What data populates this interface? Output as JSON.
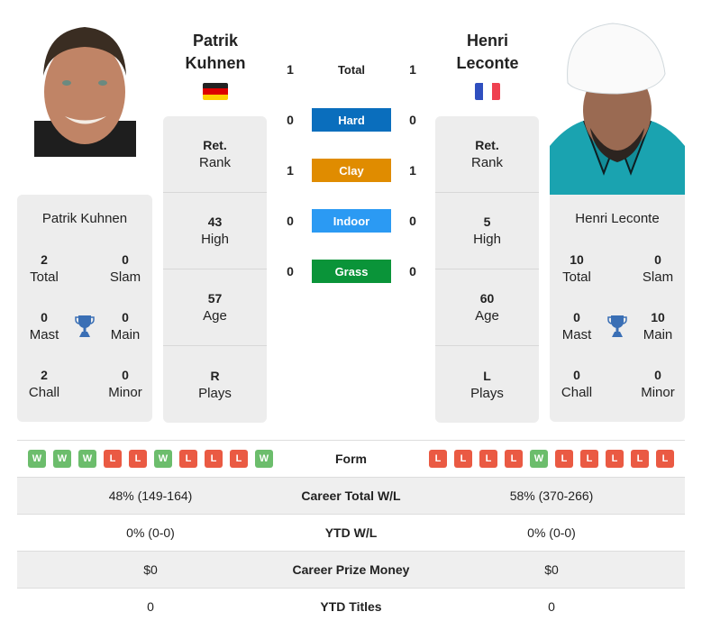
{
  "player1": {
    "name_line1": "Patrik",
    "name_line2": "Kuhnen",
    "full_name": "Patrik Kuhnen",
    "country": "Germany",
    "flag_colors": [
      "#000000",
      "#dd0000",
      "#ffce00"
    ],
    "rank": {
      "value": "Ret.",
      "label": "Rank"
    },
    "high": {
      "value": "43",
      "label": "High"
    },
    "age": {
      "value": "57",
      "label": "Age"
    },
    "plays": {
      "value": "R",
      "label": "Plays"
    },
    "titles": {
      "total": {
        "value": "2",
        "label": "Total"
      },
      "slam": {
        "value": "0",
        "label": "Slam"
      },
      "mast": {
        "value": "0",
        "label": "Mast"
      },
      "main": {
        "value": "0",
        "label": "Main"
      },
      "chall": {
        "value": "2",
        "label": "Chall"
      },
      "minor": {
        "value": "0",
        "label": "Minor"
      }
    },
    "form": [
      "W",
      "W",
      "W",
      "L",
      "L",
      "W",
      "L",
      "L",
      "L",
      "W"
    ],
    "career_wl": "48% (149-164)",
    "ytd_wl": "0% (0-0)",
    "prize_money": "$0",
    "ytd_titles": "0"
  },
  "player2": {
    "name_line1": "Henri",
    "name_line2": "Leconte",
    "full_name": "Henri Leconte",
    "country": "France",
    "flag_colors": [
      "#2f4fbf",
      "#ffffff",
      "#ef4150"
    ],
    "rank": {
      "value": "Ret.",
      "label": "Rank"
    },
    "high": {
      "value": "5",
      "label": "High"
    },
    "age": {
      "value": "60",
      "label": "Age"
    },
    "plays": {
      "value": "L",
      "label": "Plays"
    },
    "titles": {
      "total": {
        "value": "10",
        "label": "Total"
      },
      "slam": {
        "value": "0",
        "label": "Slam"
      },
      "mast": {
        "value": "0",
        "label": "Mast"
      },
      "main": {
        "value": "10",
        "label": "Main"
      },
      "chall": {
        "value": "0",
        "label": "Chall"
      },
      "minor": {
        "value": "0",
        "label": "Minor"
      }
    },
    "form": [
      "L",
      "L",
      "L",
      "L",
      "W",
      "L",
      "L",
      "L",
      "L",
      "L"
    ],
    "career_wl": "58% (370-266)",
    "ytd_wl": "0% (0-0)",
    "prize_money": "$0",
    "ytd_titles": "0"
  },
  "h2h": [
    {
      "label": "Total",
      "p1": "1",
      "p2": "1",
      "color": ""
    },
    {
      "label": "Hard",
      "p1": "0",
      "p2": "0",
      "color": "#0a6ebd"
    },
    {
      "label": "Clay",
      "p1": "1",
      "p2": "1",
      "color": "#e08c00"
    },
    {
      "label": "Indoor",
      "p1": "0",
      "p2": "0",
      "color": "#2b9af3"
    },
    {
      "label": "Grass",
      "p1": "0",
      "p2": "0",
      "color": "#0a9439"
    }
  ],
  "stats_labels": {
    "form": "Form",
    "career_wl": "Career Total W/L",
    "ytd_wl": "YTD W/L",
    "prize_money": "Career Prize Money",
    "ytd_titles": "YTD Titles"
  },
  "colors": {
    "win": "#6cbd6c",
    "loss": "#ea5a43",
    "trophy": "#3a6fb5",
    "card_bg": "#ededed"
  }
}
